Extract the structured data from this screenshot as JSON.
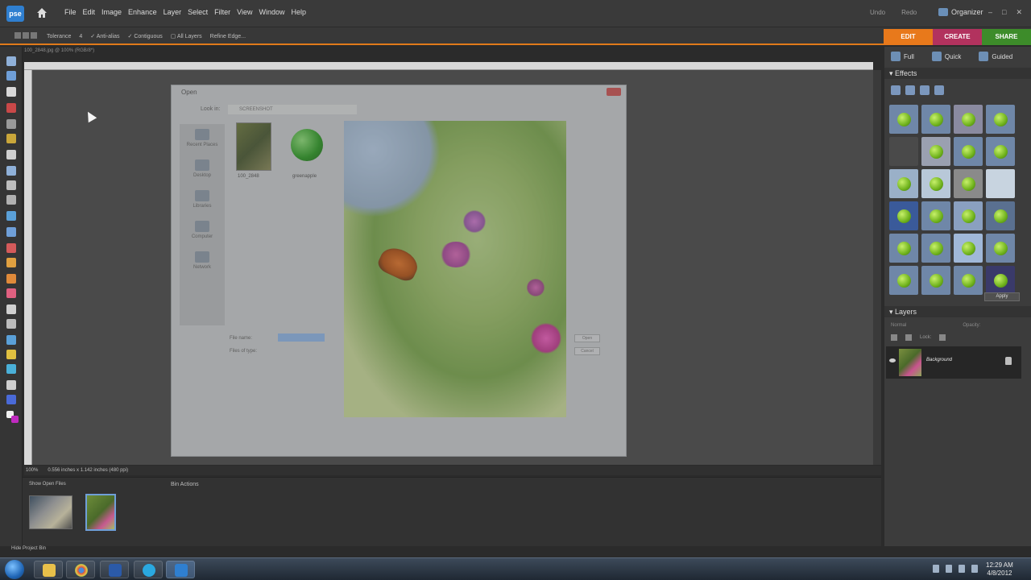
{
  "app": {
    "logo_text": "pse",
    "menu": [
      "File",
      "Edit",
      "Image",
      "Enhance",
      "Layer",
      "Select",
      "Filter",
      "View",
      "Window",
      "Help"
    ],
    "undo": "Undo",
    "redo": "Redo",
    "organizer": "Organizer"
  },
  "options_bar": {
    "tolerance_label": "Tolerance",
    "tolerance_value": "4",
    "anti_alias": "Anti-alias",
    "contiguous": "Contiguous",
    "all_layers": "All Layers",
    "refine_edge": "Refine Edge..."
  },
  "mode_tabs": [
    "EDIT",
    "CREATE",
    "SHARE"
  ],
  "edit_modes": [
    "Full",
    "Quick",
    "Guided"
  ],
  "document": {
    "title": "100_2848.jpg @ 100% (RGB/8*)",
    "zoom": "100%",
    "info": "0.556 inches x 1.142 inches (480 ppi)"
  },
  "dialog": {
    "title": "Open",
    "look_in_label": "Look in:",
    "look_in_value": "SCREENSHOT",
    "nav": [
      "Recent Places",
      "Desktop",
      "Libraries",
      "Computer",
      "Network"
    ],
    "files": [
      "100_2848",
      "greenapple"
    ],
    "file_name_label": "File name:",
    "file_type_label": "Files of type:",
    "open_button": "Open",
    "cancel_button": "Cancel"
  },
  "panels": {
    "effects_title": "Effects",
    "apply_label": "Apply",
    "layers_title": "Layers",
    "blend_mode": "Normal",
    "opacity_label": "Opacity:",
    "lock_label": "Lock:",
    "layer_name": "Background"
  },
  "bin": {
    "show_open_files": "Show Open Files",
    "bin_actions": "Bin Actions",
    "hide_project_bin": "Hide Project Bin"
  },
  "taskbar": {
    "time": "12:29 AM",
    "date": "4/8/2012"
  },
  "colors": {
    "edit_tab": "#e8791b",
    "create_tab": "#b2325e",
    "share_tab": "#3d8c2a",
    "accent_orange": "#e07a1a"
  }
}
